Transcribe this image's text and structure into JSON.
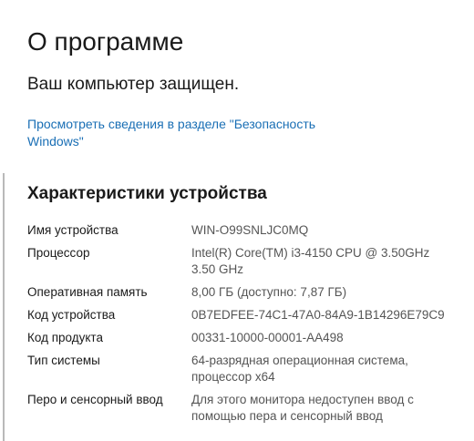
{
  "page": {
    "title": "О программе",
    "protection_status": "Ваш компьютер защищен.",
    "security_link": "Просмотреть сведения в разделе \"Безопасность Windows\""
  },
  "device_specs": {
    "title": "Характеристики устройства",
    "rows": [
      {
        "label": "Имя устройства",
        "value": "WIN-O99SNLJC0MQ"
      },
      {
        "label": "Процессор",
        "value": "Intel(R) Core(TM) i3-4150 CPU @ 3.50GHz   3.50 GHz"
      },
      {
        "label": "Оперативная память",
        "value": "8,00 ГБ (доступно: 7,87 ГБ)"
      },
      {
        "label": "Код устройства",
        "value": "0B7EDFEE-74C1-47A0-84A9-1B14296E79C9"
      },
      {
        "label": "Код продукта",
        "value": "00331-10000-00001-AA498"
      },
      {
        "label": "Тип системы",
        "value": "64-разрядная операционная система, процессор x64"
      },
      {
        "label": "Перо и сенсорный ввод",
        "value": "Для этого монитора недоступен ввод с помощью пера и сенсорный ввод"
      }
    ]
  }
}
